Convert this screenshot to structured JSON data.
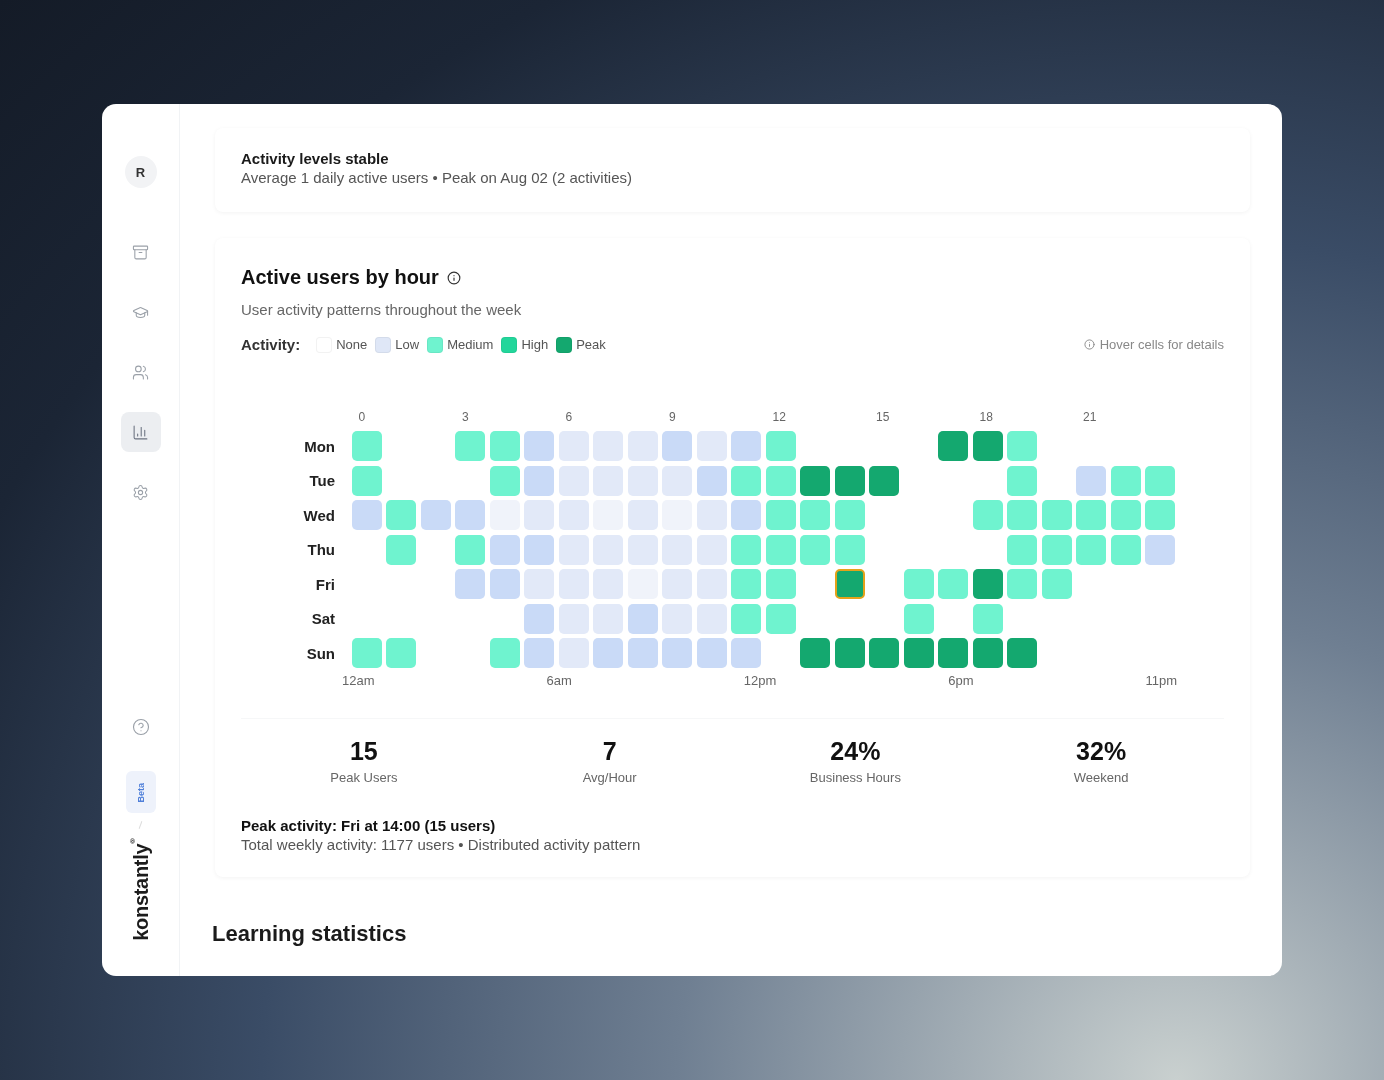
{
  "sidebar": {
    "avatar": "R",
    "items": [
      {
        "kind": "archive",
        "selected": false
      },
      {
        "kind": "courses",
        "selected": false
      },
      {
        "kind": "users",
        "selected": false
      },
      {
        "kind": "reports",
        "selected": true
      },
      {
        "kind": "settings",
        "selected": false
      }
    ],
    "badge": "Beta",
    "logo": "konstantly",
    "logo_mark": "®"
  },
  "summary": {
    "title": "Activity levels stable",
    "text": "Average 1 daily active users • Peak on Aug 02 (2 activities)"
  },
  "heatmap_card": {
    "title": "Active users by hour",
    "subtitle": "User activity patterns throughout the week",
    "legend_label": "Activity:",
    "legend": [
      {
        "label": "None",
        "color": "#ffffff"
      },
      {
        "label": "Low",
        "color": "#dfe7f7"
      },
      {
        "label": "Medium",
        "color": "#6ff3cf"
      },
      {
        "label": "High",
        "color": "#22d69b"
      },
      {
        "label": "Peak",
        "color": "#14a86f"
      }
    ],
    "hint": "Hover cells for details",
    "hour_labels": [
      "0",
      "3",
      "6",
      "9",
      "12",
      "15",
      "18",
      "21"
    ],
    "rows": [
      {
        "day": "Mon",
        "cells": [
          {
            "kind": "medium"
          },
          {
            "kind": "none"
          },
          {
            "kind": "none"
          },
          {
            "kind": "medium"
          },
          {
            "kind": "medium"
          },
          {
            "kind": "lowplus"
          },
          {
            "kind": "low"
          },
          {
            "kind": "low"
          },
          {
            "kind": "low"
          },
          {
            "kind": "lowplus"
          },
          {
            "kind": "low"
          },
          {
            "kind": "lowplus"
          },
          {
            "kind": "medium"
          },
          {
            "kind": "none"
          },
          {
            "kind": "none"
          },
          {
            "kind": "none"
          },
          {
            "kind": "none"
          },
          {
            "kind": "peak"
          },
          {
            "kind": "peak"
          },
          {
            "kind": "medium"
          },
          {
            "kind": "none"
          },
          {
            "kind": "none"
          },
          {
            "kind": "none"
          },
          {
            "kind": "none"
          }
        ]
      },
      {
        "day": "Tue",
        "cells": [
          {
            "kind": "medium"
          },
          {
            "kind": "none"
          },
          {
            "kind": "none"
          },
          {
            "kind": "none"
          },
          {
            "kind": "medium"
          },
          {
            "kind": "lowplus"
          },
          {
            "kind": "low"
          },
          {
            "kind": "low"
          },
          {
            "kind": "low"
          },
          {
            "kind": "low"
          },
          {
            "kind": "lowplus"
          },
          {
            "kind": "medium"
          },
          {
            "kind": "medium"
          },
          {
            "kind": "peak"
          },
          {
            "kind": "peak"
          },
          {
            "kind": "peak"
          },
          {
            "kind": "none"
          },
          {
            "kind": "none"
          },
          {
            "kind": "none"
          },
          {
            "kind": "medium"
          },
          {
            "kind": "none"
          },
          {
            "kind": "lowplus"
          },
          {
            "kind": "medium"
          },
          {
            "kind": "medium"
          }
        ]
      },
      {
        "day": "Wed",
        "cells": [
          {
            "kind": "lowplus"
          },
          {
            "kind": "medium"
          },
          {
            "kind": "lowplus"
          },
          {
            "kind": "lowplus"
          },
          {
            "kind": "faint"
          },
          {
            "kind": "low"
          },
          {
            "kind": "low"
          },
          {
            "kind": "faint"
          },
          {
            "kind": "low"
          },
          {
            "kind": "faint"
          },
          {
            "kind": "low"
          },
          {
            "kind": "lowplus"
          },
          {
            "kind": "medium"
          },
          {
            "kind": "medium"
          },
          {
            "kind": "medium"
          },
          {
            "kind": "none"
          },
          {
            "kind": "none"
          },
          {
            "kind": "none"
          },
          {
            "kind": "medium"
          },
          {
            "kind": "medium"
          },
          {
            "kind": "medium"
          },
          {
            "kind": "medium"
          },
          {
            "kind": "medium"
          },
          {
            "kind": "medium"
          }
        ]
      },
      {
        "day": "Thu",
        "cells": [
          {
            "kind": "none"
          },
          {
            "kind": "medium"
          },
          {
            "kind": "none"
          },
          {
            "kind": "medium"
          },
          {
            "kind": "lowplus"
          },
          {
            "kind": "lowplus"
          },
          {
            "kind": "low"
          },
          {
            "kind": "low"
          },
          {
            "kind": "low"
          },
          {
            "kind": "low"
          },
          {
            "kind": "low"
          },
          {
            "kind": "medium"
          },
          {
            "kind": "medium"
          },
          {
            "kind": "medium"
          },
          {
            "kind": "medium"
          },
          {
            "kind": "none"
          },
          {
            "kind": "none"
          },
          {
            "kind": "none"
          },
          {
            "kind": "none"
          },
          {
            "kind": "medium"
          },
          {
            "kind": "medium"
          },
          {
            "kind": "medium"
          },
          {
            "kind": "medium"
          },
          {
            "kind": "lowplus"
          }
        ]
      },
      {
        "day": "Fri",
        "cells": [
          {
            "kind": "none"
          },
          {
            "kind": "none"
          },
          {
            "kind": "none"
          },
          {
            "kind": "lowplus"
          },
          {
            "kind": "lowplus"
          },
          {
            "kind": "low"
          },
          {
            "kind": "low"
          },
          {
            "kind": "low"
          },
          {
            "kind": "faint"
          },
          {
            "kind": "low"
          },
          {
            "kind": "low"
          },
          {
            "kind": "medium"
          },
          {
            "kind": "medium"
          },
          {
            "kind": "none"
          },
          {
            "kind": "focused"
          },
          {
            "kind": "none"
          },
          {
            "kind": "medium"
          },
          {
            "kind": "medium"
          },
          {
            "kind": "peak"
          },
          {
            "kind": "medium"
          },
          {
            "kind": "medium"
          },
          {
            "kind": "none"
          },
          {
            "kind": "none"
          },
          {
            "kind": "none"
          }
        ]
      },
      {
        "day": "Sat",
        "cells": [
          {
            "kind": "none"
          },
          {
            "kind": "none"
          },
          {
            "kind": "none"
          },
          {
            "kind": "none"
          },
          {
            "kind": "none"
          },
          {
            "kind": "lowplus"
          },
          {
            "kind": "low"
          },
          {
            "kind": "low"
          },
          {
            "kind": "lowplus"
          },
          {
            "kind": "low"
          },
          {
            "kind": "low"
          },
          {
            "kind": "medium"
          },
          {
            "kind": "medium"
          },
          {
            "kind": "none"
          },
          {
            "kind": "none"
          },
          {
            "kind": "none"
          },
          {
            "kind": "medium"
          },
          {
            "kind": "none"
          },
          {
            "kind": "medium"
          },
          {
            "kind": "none"
          },
          {
            "kind": "none"
          },
          {
            "kind": "none"
          },
          {
            "kind": "none"
          },
          {
            "kind": "none"
          }
        ]
      },
      {
        "day": "Sun",
        "cells": [
          {
            "kind": "medium"
          },
          {
            "kind": "medium"
          },
          {
            "kind": "none"
          },
          {
            "kind": "none"
          },
          {
            "kind": "medium"
          },
          {
            "kind": "lowplus"
          },
          {
            "kind": "low"
          },
          {
            "kind": "lowplus"
          },
          {
            "kind": "lowplus"
          },
          {
            "kind": "lowplus"
          },
          {
            "kind": "lowplus"
          },
          {
            "kind": "lowplus"
          },
          {
            "kind": "none"
          },
          {
            "kind": "peak"
          },
          {
            "kind": "peak"
          },
          {
            "kind": "peak"
          },
          {
            "kind": "peak"
          },
          {
            "kind": "peak"
          },
          {
            "kind": "peak"
          },
          {
            "kind": "peak"
          },
          {
            "kind": "none"
          },
          {
            "kind": "none"
          },
          {
            "kind": "none"
          },
          {
            "kind": "none"
          }
        ]
      }
    ],
    "axis_labels": [
      "12am",
      "6am",
      "12pm",
      "6pm",
      "11pm"
    ],
    "stats": [
      {
        "value": "15",
        "label": "Peak Users"
      },
      {
        "value": "7",
        "label": "Avg/Hour"
      },
      {
        "value": "24%",
        "label": "Business Hours"
      },
      {
        "value": "32%",
        "label": "Weekend"
      }
    ],
    "footer_title": "Peak activity: Fri at 14:00 (15 users)",
    "footer_text": "Total weekly activity: 1177 users • Distributed activity pattern"
  },
  "section_title": "Learning statistics"
}
